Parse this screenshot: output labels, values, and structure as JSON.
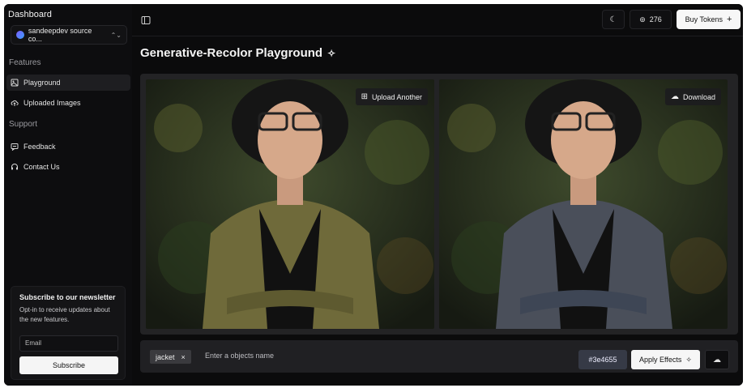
{
  "sidebar": {
    "title": "Dashboard",
    "account": {
      "name": "sandeepdev source co..."
    },
    "sections": [
      {
        "label": "Features",
        "items": [
          {
            "label": "Playground",
            "icon": "image-icon",
            "active": true
          },
          {
            "label": "Uploaded Images",
            "icon": "cloud-upload-icon",
            "active": false
          }
        ]
      },
      {
        "label": "Support",
        "items": [
          {
            "label": "Feedback",
            "icon": "message-icon",
            "active": false
          },
          {
            "label": "Contact Us",
            "icon": "headset-icon",
            "active": false
          }
        ]
      }
    ],
    "newsletter": {
      "title": "Subscribe to our newsletter",
      "text": "Opt-in to receive updates about the new features.",
      "email_placeholder": "Email",
      "button": "Subscribe"
    }
  },
  "topbar": {
    "credits": "276",
    "buy_label": "Buy Tokens"
  },
  "page": {
    "title": "Generative-Recolor Playground"
  },
  "canvas": {
    "upload_label": "Upload Another",
    "download_label": "Download"
  },
  "controls": {
    "chip_label": "jacket",
    "object_placeholder": "Enter a objects name",
    "color_value": "#3e4655",
    "apply_label": "Apply Effects"
  },
  "colors": {
    "original_jacket": "#6f6a3a",
    "recolored_jacket": "#3e4655",
    "accent_bg": "#0b0b0c"
  }
}
